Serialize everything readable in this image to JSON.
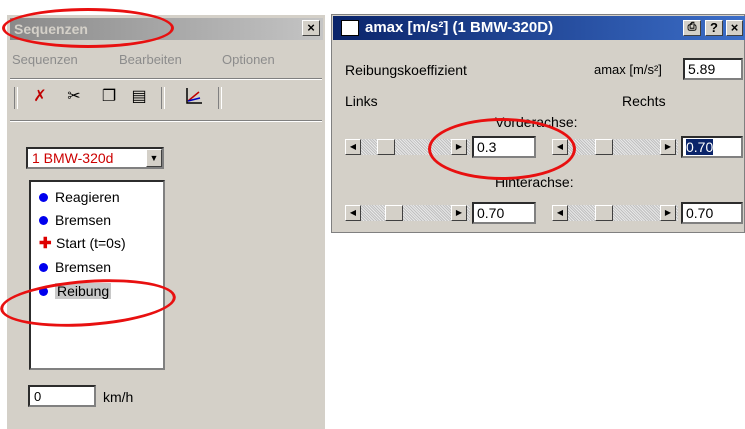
{
  "left_window": {
    "title": "Sequenzen",
    "close_label": "×",
    "menu": [
      "Sequenzen",
      "Bearbeiten",
      "Optionen"
    ],
    "vehicle_select": {
      "value": "1 BMW-320d"
    },
    "sequence_items": [
      {
        "label": "Reagieren",
        "icon": "blue-dot-icon"
      },
      {
        "label": "Bremsen",
        "icon": "blue-dot-icon"
      },
      {
        "label": "Start (t=0s)",
        "icon": "red-start-icon"
      },
      {
        "label": "Bremsen",
        "icon": "blue-dot-icon"
      },
      {
        "label": "Reibung",
        "icon": "blue-dot-icon",
        "selected": true
      }
    ],
    "speed": {
      "value": "0",
      "unit": "km/h"
    }
  },
  "right_window": {
    "title": "amax [m/s²] (1  BMW-320D)",
    "buttons": [
      "?",
      "×"
    ],
    "friction_label": "Reibungskoeffizient",
    "amax_label": "amax [m/s²]",
    "amax_value": "5.89",
    "left_label": "Links",
    "right_label": "Rechts",
    "front_axle_label": "Vorderachse:",
    "rear_axle_label": "Hinterachse:",
    "front_left_value": "0.3",
    "front_right_value": "0.70",
    "rear_left_value": "0.70",
    "rear_right_value": "0.70"
  },
  "colors": {
    "active_title": "#0a246a",
    "annotation": "#e81010",
    "item_dot": "#0000ee"
  }
}
